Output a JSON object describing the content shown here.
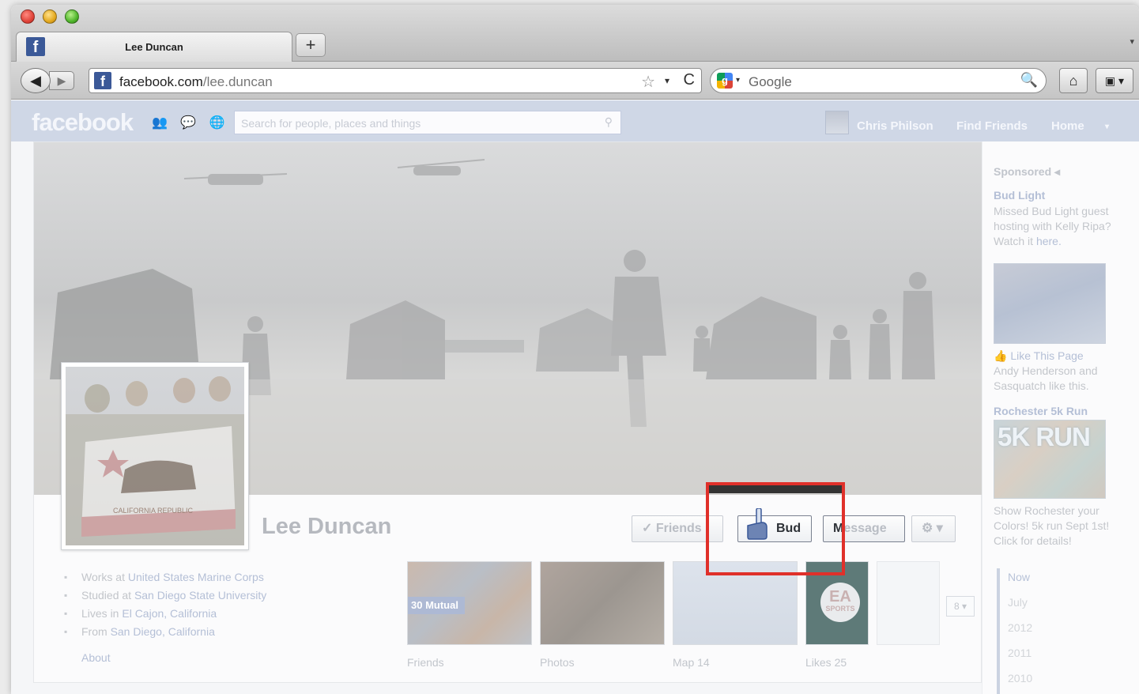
{
  "browser": {
    "tab_title": "Lee Duncan",
    "new_tab_label": "+",
    "tab_menu": "▾",
    "back": "◀",
    "forward": "▶",
    "url_domain": "facebook.com",
    "url_path": "/lee.duncan",
    "url_star": "☆",
    "url_dropdown": "▾",
    "reload": "C",
    "search_engine": "Google",
    "search_dropdown": "▾",
    "search_icon": "🔍",
    "home": "⌂",
    "bookmarks": "▣ ▾",
    "favicon": "f"
  },
  "fb_header": {
    "logo": "facebook",
    "notif_icons": "👥 💬 🌐",
    "search_placeholder": "Search for people, places and things",
    "user_name": "Chris Philson",
    "find_friends": "Find Friends",
    "home": "Home",
    "menu_caret": "▾"
  },
  "profile": {
    "name": "Lee Duncan",
    "buttons": {
      "friends": "✓ Friends",
      "bud": "Bud",
      "message_first": "M",
      "message_rest": "essage",
      "gear": "⚙ ▾"
    },
    "about": [
      {
        "icon": "▪",
        "prefix": "Works at ",
        "link": "United States Marine Corps"
      },
      {
        "icon": "▪",
        "prefix": "Studied at ",
        "link": "San Diego State University"
      },
      {
        "icon": "▪",
        "prefix": "Lives in ",
        "link": "El Cajon, California"
      },
      {
        "icon": "▪",
        "prefix": "From ",
        "link": "San Diego, California"
      }
    ],
    "about_link": "About",
    "tiles": {
      "mutual_badge": "30 Mutual",
      "friends_label": "Friends",
      "photos_label": "Photos",
      "map_label": "Map 14",
      "likes_label": "Likes 25",
      "ea_logo": "EA",
      "ea_sub": "SPORTS",
      "more": "8 ▾"
    },
    "flag_text": "CALIFORNIA REPUBLIC"
  },
  "sidebar": {
    "sponsored": "Sponsored",
    "ad1_title": "Bud Light",
    "ad1_text": "Missed Bud Light guest hosting with Kelly Ripa? Watch it ",
    "ad1_link": "here.",
    "ad1_like": "Like This Page",
    "ad1_social": "Andy Henderson and Sasquatch like this.",
    "ad2_title": "Rochester 5k Run",
    "ad2_image_text": "5K RUN",
    "ad2_text": "Show Rochester your Colors! 5k run Sept 1st! Click for details!",
    "years": [
      "Now",
      "July",
      "2012",
      "2011",
      "2010"
    ]
  },
  "colors": {
    "facebook_blue": "#3b5998",
    "highlight_red": "#e0302a"
  }
}
